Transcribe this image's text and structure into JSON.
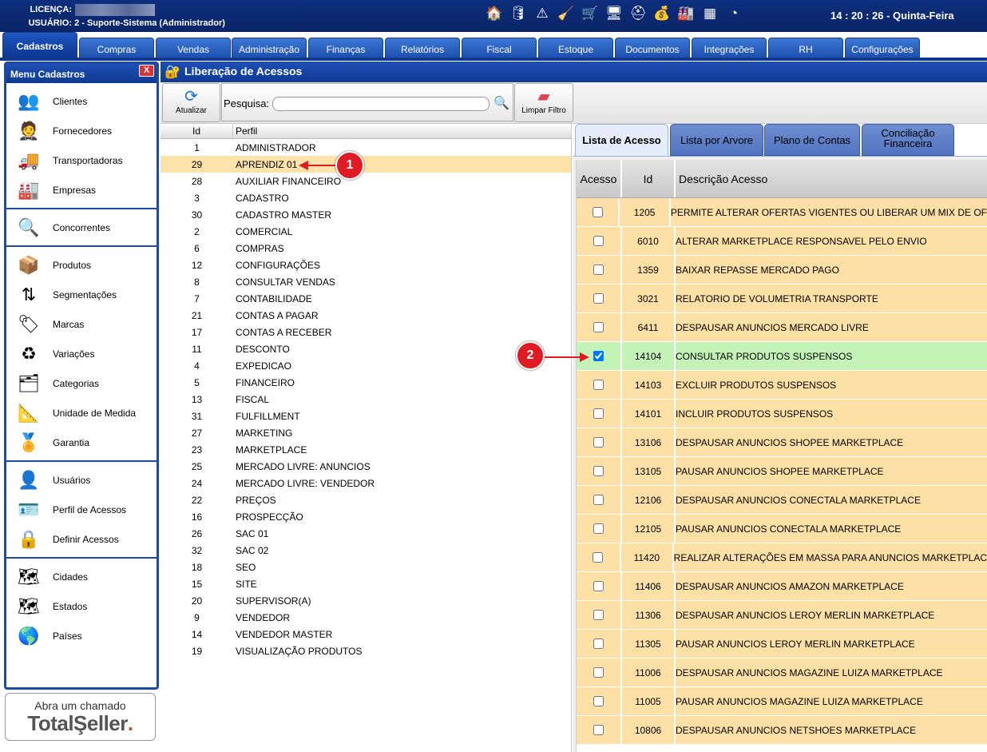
{
  "header": {
    "licenca_label": "LICENÇA:",
    "usuario_label": "USUÁRIO:",
    "usuario_value": "2 - Suporte-Sistema (Administrador)",
    "clock": "14 : 20 : 26 - Quinta-Feira",
    "icons": [
      "store-icon",
      "database-icon",
      "warning-icon",
      "broom-icon",
      "cart-icon",
      "monitor-icon",
      "lifebuoy-icon",
      "money-hand-icon",
      "factory-icon",
      "apps-grid-icon",
      "clock-icon"
    ]
  },
  "main_tabs": [
    {
      "label": "Cadastros",
      "active": true
    },
    {
      "label": "Compras"
    },
    {
      "label": "Vendas"
    },
    {
      "label": "Administração"
    },
    {
      "label": "Finanças"
    },
    {
      "label": "Relatórios"
    },
    {
      "label": "Fiscal"
    },
    {
      "label": "Estoque"
    },
    {
      "label": "Documentos"
    },
    {
      "label": "Integrações"
    },
    {
      "label": "RH"
    },
    {
      "label": "Configurações"
    }
  ],
  "sidebar": {
    "title": "Menu Cadastros",
    "close": "X",
    "groups": [
      [
        {
          "label": "Clientes",
          "icon": "clients-icon"
        },
        {
          "label": "Fornecedores",
          "icon": "supplier-icon"
        },
        {
          "label": "Transportadoras",
          "icon": "truck-icon"
        },
        {
          "label": "Empresas",
          "icon": "company-icon"
        }
      ],
      [
        {
          "label": "Concorrentes",
          "icon": "competitor-icon"
        }
      ],
      [
        {
          "label": "Produtos",
          "icon": "box-icon"
        },
        {
          "label": "Segmentações",
          "icon": "segment-icon"
        },
        {
          "label": "Marcas",
          "icon": "tag-icon"
        },
        {
          "label": "Variações",
          "icon": "variation-icon"
        },
        {
          "label": "Categorias",
          "icon": "category-icon"
        },
        {
          "label": "Unidade de Medida",
          "icon": "caliper-icon"
        },
        {
          "label": "Garantia",
          "icon": "warranty-icon"
        }
      ],
      [
        {
          "label": "Usuários",
          "icon": "user-icon"
        },
        {
          "label": "Perfil de Acessos",
          "icon": "profile-card-icon"
        },
        {
          "label": "Definir Acessos",
          "icon": "lock-network-icon"
        }
      ],
      [
        {
          "label": "Cidades",
          "icon": "city-map-icon"
        },
        {
          "label": "Estados",
          "icon": "state-map-icon"
        },
        {
          "label": "Países",
          "icon": "globe-icon"
        }
      ]
    ],
    "support_line1": "Abra um chamado",
    "support_brand_a": "TotalŞeller",
    "support_brand_b": "."
  },
  "page": {
    "title": "Liberação de Acessos",
    "refresh_label": "Atualizar",
    "search_label": "Pesquisa:",
    "search_value": "",
    "clear_label": "Limpar Filtro"
  },
  "profiles": {
    "col_id": "Id",
    "col_profile": "Perfil",
    "selected_id": "29",
    "rows": [
      [
        "1",
        "ADMINISTRADOR"
      ],
      [
        "29",
        "APRENDIZ 01"
      ],
      [
        "28",
        "AUXILIAR FINANCEIRO"
      ],
      [
        "3",
        "CADASTRO"
      ],
      [
        "30",
        "CADASTRO MASTER"
      ],
      [
        "2",
        "COMERCIAL"
      ],
      [
        "6",
        "COMPRAS"
      ],
      [
        "12",
        "CONFIGURAÇÕES"
      ],
      [
        "8",
        "CONSULTAR VENDAS"
      ],
      [
        "7",
        "CONTABILIDADE"
      ],
      [
        "21",
        "CONTAS A PAGAR"
      ],
      [
        "17",
        "CONTAS A RECEBER"
      ],
      [
        "11",
        "DESCONTO"
      ],
      [
        "4",
        "EXPEDICAO"
      ],
      [
        "5",
        "FINANCEIRO"
      ],
      [
        "13",
        "FISCAL"
      ],
      [
        "31",
        "FULFILLMENT"
      ],
      [
        "27",
        "MARKETING"
      ],
      [
        "23",
        "MARKETPLACE"
      ],
      [
        "25",
        "MERCADO LIVRE: ANUNCIOS"
      ],
      [
        "24",
        "MERCADO LIVRE: VENDEDOR"
      ],
      [
        "22",
        "PREÇOS"
      ],
      [
        "16",
        "PROSPECÇÃO"
      ],
      [
        "26",
        "SAC 01"
      ],
      [
        "32",
        "SAC 02"
      ],
      [
        "18",
        "SEO"
      ],
      [
        "15",
        "SITE"
      ],
      [
        "20",
        "SUPERVISOR(A)"
      ],
      [
        "9",
        "VENDEDOR"
      ],
      [
        "14",
        "VENDEDOR MASTER"
      ],
      [
        "19",
        "VISUALIZAÇÃO PRODUTOS"
      ]
    ]
  },
  "right_tabs": [
    {
      "label": "Lista de Acesso",
      "active": true
    },
    {
      "label": "Lista por Arvore"
    },
    {
      "label": "Plano de Contas"
    },
    {
      "label": "Conciliação Financeira"
    }
  ],
  "access": {
    "col_acesso": "Acesso",
    "col_id": "Id",
    "col_desc": "Descrição Acesso",
    "rows": [
      {
        "id": "1205",
        "desc": "PERMITE ALTERAR OFERTAS VIGENTES OU LIBERAR UM MIX DE OF",
        "checked": false
      },
      {
        "id": "6010",
        "desc": "ALTERAR MARKETPLACE RESPONSAVEL PELO ENVIO",
        "checked": false
      },
      {
        "id": "1359",
        "desc": "BAIXAR REPASSE MERCADO PAGO",
        "checked": false
      },
      {
        "id": "3021",
        "desc": "RELATORIO DE VOLUMETRIA TRANSPORTE",
        "checked": false
      },
      {
        "id": "6411",
        "desc": "DESPAUSAR ANUNCIOS MERCADO LIVRE",
        "checked": false
      },
      {
        "id": "14104",
        "desc": "CONSULTAR PRODUTOS SUSPENSOS",
        "checked": true
      },
      {
        "id": "14103",
        "desc": "EXCLUIR PRODUTOS SUSPENSOS",
        "checked": false
      },
      {
        "id": "14101",
        "desc": "INCLUIR PRODUTOS SUSPENSOS",
        "checked": false
      },
      {
        "id": "13106",
        "desc": "DESPAUSAR ANUNCIOS SHOPEE MARKETPLACE",
        "checked": false
      },
      {
        "id": "13105",
        "desc": "PAUSAR ANUNCIOS SHOPEE MARKETPLACE",
        "checked": false
      },
      {
        "id": "12106",
        "desc": "DESPAUSAR ANUNCIOS CONECTALA MARKETPLACE",
        "checked": false
      },
      {
        "id": "12105",
        "desc": "PAUSAR ANUNCIOS CONECTALA MARKETPLACE",
        "checked": false
      },
      {
        "id": "11420",
        "desc": "REALIZAR ALTERAÇÕES EM MASSA PARA ANUNCIOS MARKETPLAC",
        "checked": false
      },
      {
        "id": "11406",
        "desc": "DESPAUSAR ANUNCIOS AMAZON MARKETPLACE",
        "checked": false
      },
      {
        "id": "11306",
        "desc": "DESPAUSAR ANUNCIOS LEROY MERLIN MARKETPLACE",
        "checked": false
      },
      {
        "id": "11305",
        "desc": "PAUSAR ANUNCIOS LEROY MERLIN MARKETPLACE",
        "checked": false
      },
      {
        "id": "11006",
        "desc": "DESPAUSAR ANUNCIOS MAGAZINE LUIZA MARKETPLACE",
        "checked": false
      },
      {
        "id": "11005",
        "desc": "PAUSAR ANUNCIOS MAGAZINE LUIZA MARKETPLACE",
        "checked": false
      },
      {
        "id": "10806",
        "desc": "DESPAUSAR ANUNCIOS NETSHOES MARKETPLACE",
        "checked": false
      }
    ]
  },
  "annotations": [
    {
      "label": "1"
    },
    {
      "label": "2"
    }
  ]
}
